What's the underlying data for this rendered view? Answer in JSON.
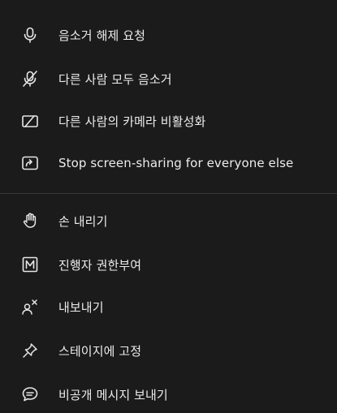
{
  "menu": {
    "group1": [
      {
        "label": "음소거 해제 요청",
        "icon": "microphone-icon"
      },
      {
        "label": "다른 사람 모두 음소거",
        "icon": "microphone-off-icon"
      },
      {
        "label": "다른 사람의 카메라 비활성화",
        "icon": "camera-off-icon"
      },
      {
        "label": "Stop screen-sharing for everyone else",
        "icon": "screen-share-icon"
      }
    ],
    "group2": [
      {
        "label": "손 내리기",
        "icon": "hand-icon"
      },
      {
        "label": "진행자 권한부여",
        "icon": "moderator-m-icon"
      },
      {
        "label": "내보내기",
        "icon": "remove-user-icon"
      },
      {
        "label": "스테이지에 고정",
        "icon": "pin-icon"
      },
      {
        "label": "비공개 메시지 보내기",
        "icon": "chat-bubble-icon"
      }
    ]
  },
  "colors": {
    "background": "#1b1b1b",
    "text": "#ececec",
    "divider": "#3a3a3a"
  }
}
